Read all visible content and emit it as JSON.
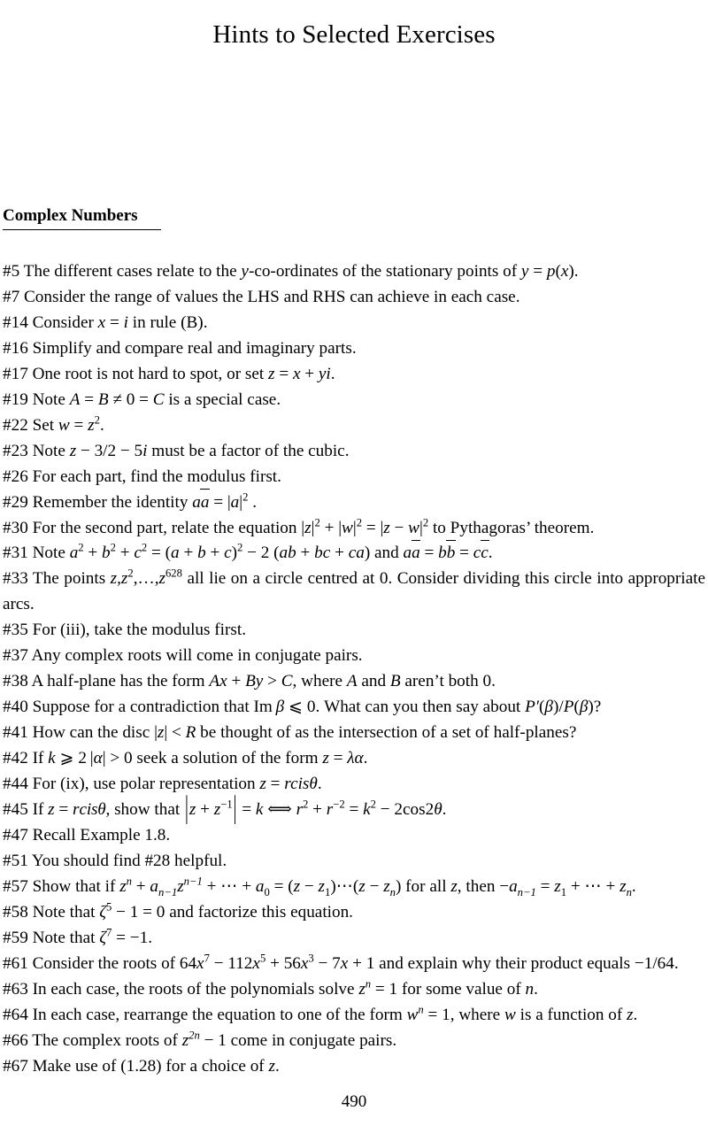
{
  "document": {
    "title": "Hints to Selected Exercises",
    "page_number": "490",
    "section": {
      "heading": "Complex Numbers"
    }
  },
  "hints": [
    {
      "id": "hint-5",
      "number": "#5",
      "text": "#5 The different cases relate to the y-co-ordinates of the stationary points of y = p(x).",
      "plain": "The different cases relate to the y-co-ordinates of the stationary points of y = p(x)."
    },
    {
      "id": "hint-7",
      "number": "#7",
      "text": "#7 Consider the range of values the LHS and RHS can achieve in each case.",
      "plain": "Consider the range of values the LHS and RHS can achieve in each case."
    },
    {
      "id": "hint-14",
      "number": "#14",
      "text": "#14 Consider x = i in rule (B).",
      "plain": "Consider x = i in rule (B)."
    },
    {
      "id": "hint-16",
      "number": "#16",
      "text": "#16 Simplify and compare real and imaginary parts.",
      "plain": "Simplify and compare real and imaginary parts."
    },
    {
      "id": "hint-17",
      "number": "#17",
      "text": "#17 One root is not hard to spot, or set z = x + yi.",
      "plain": "One root is not hard to spot, or set z = x + yi."
    },
    {
      "id": "hint-19",
      "number": "#19",
      "text": "#19 Note A = B ≠ 0 = C is a special case.",
      "plain": "Note A = B ≠ 0 = C is a special case."
    },
    {
      "id": "hint-22",
      "number": "#22",
      "text": "#22 Set w = z².",
      "plain": "Set w = z^2."
    },
    {
      "id": "hint-23",
      "number": "#23",
      "text": "#23 Note z − 3/2 − 5i must be a factor of the cubic.",
      "plain": "Note z - 3/2 - 5i must be a factor of the cubic."
    },
    {
      "id": "hint-26",
      "number": "#26",
      "text": "#26 For each part, find the modulus first.",
      "plain": "For each part, find the modulus first."
    },
    {
      "id": "hint-29",
      "number": "#29",
      "text": "#29 Remember the identity aā = |a|² .",
      "plain": "Remember the identity a a-bar = |a|^2 ."
    },
    {
      "id": "hint-30",
      "number": "#30",
      "text": "#30 For the second part, relate the equation |z|² + |w|² = |z − w|² to Pythagoras' theorem.",
      "plain": "For the second part, relate the equation |z|^2 + |w|^2 = |z - w|^2 to Pythagoras' theorem."
    },
    {
      "id": "hint-31",
      "number": "#31",
      "text": "#31 Note a² + b² + c² = (a + b + c)² − 2 (ab + bc + ca) and aā = bb̄ = cc̄.",
      "plain": "Note a^2 + b^2 + c^2 = (a+b+c)^2 - 2(ab+bc+ca) and a a-bar = b b-bar = c c-bar."
    },
    {
      "id": "hint-33",
      "number": "#33",
      "text": "#33 The points z, z², …, z⁶²⁸ all lie on a circle centred at 0. Consider dividing this circle into appropriate arcs.",
      "plain": "The points z, z^2, ..., z^628 all lie on a circle centred at 0. Consider dividing this circle into appropriate arcs."
    },
    {
      "id": "hint-35",
      "number": "#35",
      "text": "#35 For (iii), take the modulus first.",
      "plain": "For (iii), take the modulus first."
    },
    {
      "id": "hint-37",
      "number": "#37",
      "text": "#37 Any complex roots will come in conjugate pairs.",
      "plain": "Any complex roots will come in conjugate pairs."
    },
    {
      "id": "hint-38",
      "number": "#38",
      "text": "#38 A half-plane has the form Ax + By > C, where A and B aren't both 0.",
      "plain": "A half-plane has the form Ax + By > C, where A and B aren't both 0."
    },
    {
      "id": "hint-40",
      "number": "#40",
      "text": "#40 Suppose for a contradiction that Im β ⩽ 0. What can you then say about P′(β)/P(β)?",
      "plain": "Suppose for a contradiction that Im beta <= 0. What can you then say about P'(beta)/P(beta)?"
    },
    {
      "id": "hint-41",
      "number": "#41",
      "text": "#41 How can the disc |z| < R be thought of as the intersection of a set of half-planes?",
      "plain": "How can the disc |z| < R be thought of as the intersection of a set of half-planes?"
    },
    {
      "id": "hint-42",
      "number": "#42",
      "text": "#42 If k ⩾ 2 |α| > 0 seek a solution of the form z = λα.",
      "plain": "If k >= 2|alpha| > 0 seek a solution of the form z = lambda alpha."
    },
    {
      "id": "hint-44",
      "number": "#44",
      "text": "#44 For (ix), use polar representation z = r cis θ.",
      "plain": "For (ix), use polar representation z = r cis theta."
    },
    {
      "id": "hint-45",
      "number": "#45",
      "text": "#45 If z = r cis θ, show that |z + z⁻¹| = k ⟺ r² + r⁻² = k² − 2 cos 2θ.",
      "plain": "If z = r cis theta, show that |z + z^-1| = k <=> r^2 + r^-2 = k^2 - 2cos2theta."
    },
    {
      "id": "hint-47",
      "number": "#47",
      "text": "#47 Recall Example 1.8.",
      "plain": "Recall Example 1.8."
    },
    {
      "id": "hint-51",
      "number": "#51",
      "text": "#51 You should find #28 helpful.",
      "plain": "You should find #28 helpful."
    },
    {
      "id": "hint-57",
      "number": "#57",
      "text": "#57 Show that if zⁿ + aₙ₋₁zⁿ⁻¹ + ⋯ + a₀ = (z − z₁) ⋯ (z − zₙ) for all z, then −aₙ₋₁ = z₁ + ⋯ + zₙ.",
      "plain": "Show that if z^n + a_{n-1} z^{n-1} + ... + a_0 = (z-z_1)...(z-z_n) for all z, then -a_{n-1} = z_1 + ... + z_n."
    },
    {
      "id": "hint-58",
      "number": "#58",
      "text": "#58 Note that ζ⁵ − 1 = 0 and factorize this equation.",
      "plain": "Note that zeta^5 - 1 = 0 and factorize this equation."
    },
    {
      "id": "hint-59",
      "number": "#59",
      "text": "#59 Note that ζ⁷ = −1.",
      "plain": "Note that zeta^7 = -1."
    },
    {
      "id": "hint-61",
      "number": "#61",
      "text": "#61 Consider the roots of 64x⁷ − 112x⁵ + 56x³ − 7x + 1 and explain why their product equals −1/64.",
      "plain": "Consider the roots of 64x^7 - 112x^5 + 56x^3 - 7x + 1 and explain why their product equals -1/64."
    },
    {
      "id": "hint-63",
      "number": "#63",
      "text": "#63 In each case, the roots of the polynomials solve zⁿ = 1 for some value of n.",
      "plain": "In each case, the roots of the polynomials solve z^n = 1 for some value of n."
    },
    {
      "id": "hint-64",
      "number": "#64",
      "text": "#64 In each case, rearrange the equation to one of the form wⁿ = 1, where w is a function of z.",
      "plain": "In each case, rearrange the equation to one of the form w^n = 1, where w is a function of z."
    },
    {
      "id": "hint-66",
      "number": "#66",
      "text": "#66 The complex roots of z²ⁿ − 1 come in conjugate pairs.",
      "plain": "The complex roots of z^{2n} - 1 come in conjugate pairs."
    },
    {
      "id": "hint-67",
      "number": "#67",
      "text": "#67 Make use of (1.28) for a choice of z.",
      "plain": "Make use of (1.28) for a choice of z."
    }
  ]
}
